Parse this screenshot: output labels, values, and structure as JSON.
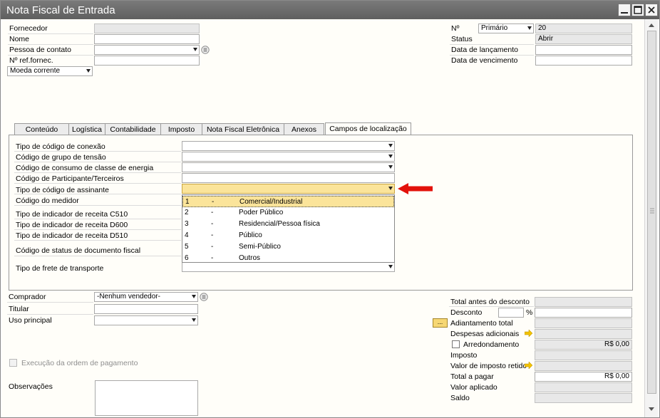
{
  "window": {
    "title": "Nota Fiscal de Entrada"
  },
  "header_left": {
    "fornecedor_label": "Fornecedor",
    "nome_label": "Nome",
    "pessoa_contato_label": "Pessoa de contato",
    "ref_fornec_label": "Nº ref.fornec.",
    "moeda": "Moeda corrente"
  },
  "header_right": {
    "numero_label": "Nº",
    "series": "Primário",
    "numero": "20",
    "status_label": "Status",
    "status": "Abrir",
    "data_lancamento_label": "Data de lançamento",
    "data_vencimento_label": "Data de vencimento"
  },
  "tabs": [
    {
      "label": "Conteúdo"
    },
    {
      "label": "Logística"
    },
    {
      "label": "Contabilidade"
    },
    {
      "label": "Imposto"
    },
    {
      "label": "Nota Fiscal Eletrônica"
    },
    {
      "label": "Anexos"
    },
    {
      "label": "Campos de localização"
    }
  ],
  "panel": {
    "fields": [
      "Tipo de código de conexão",
      "Código de grupo de tensão",
      "Código de consumo de classe de energia",
      "Código de Participante/Terceiros",
      "Tipo de código de assinante",
      "Código do medidor",
      "Tipo de indicador de receita C510",
      "Tipo de indicador de receita D600",
      "Tipo de indicador de receita D510",
      "Código de status de documento fiscal",
      "Tipo de frete de transporte"
    ],
    "dropdown_options": [
      {
        "code": "1",
        "sep": "-",
        "text": "Comercial/Industrial"
      },
      {
        "code": "2",
        "sep": "-",
        "text": "Poder Público"
      },
      {
        "code": "3",
        "sep": "-",
        "text": "Residencial/Pessoa física"
      },
      {
        "code": "4",
        "sep": "-",
        "text": "Público"
      },
      {
        "code": "5",
        "sep": "-",
        "text": "Semi-Público"
      },
      {
        "code": "6",
        "sep": "-",
        "text": "Outros"
      }
    ]
  },
  "footer_left": {
    "comprador_label": "Comprador",
    "comprador": "-Nenhum vendedor-",
    "titular_label": "Titular",
    "uso_principal_label": "Uso principal",
    "execucao_label": "Execução da ordem de pagamento",
    "observacoes_label": "Observações"
  },
  "footer_right": {
    "total_antes_label": "Total antes do desconto",
    "desconto_label": "Desconto",
    "percent": "%",
    "adiantamento_btn": "...",
    "adiantamento_label": "Adiantamento total",
    "despesas_label": "Despesas adicionais",
    "arredondamento_label": "Arredondamento",
    "arredondamento_value": "R$ 0,00",
    "imposto_label": "Imposto",
    "valor_imposto_label": "Valor de imposto retidc",
    "total_pagar_label": "Total a pagar",
    "total_pagar_value": "R$ 0,00",
    "valor_aplicado_label": "Valor aplicado",
    "saldo_label": "Saldo"
  },
  "colors": {
    "titlebar": "#666666",
    "selected_item": "#fbe49a",
    "annotation_arrow": "#e3120b",
    "link_arrow": "#f2c200"
  }
}
